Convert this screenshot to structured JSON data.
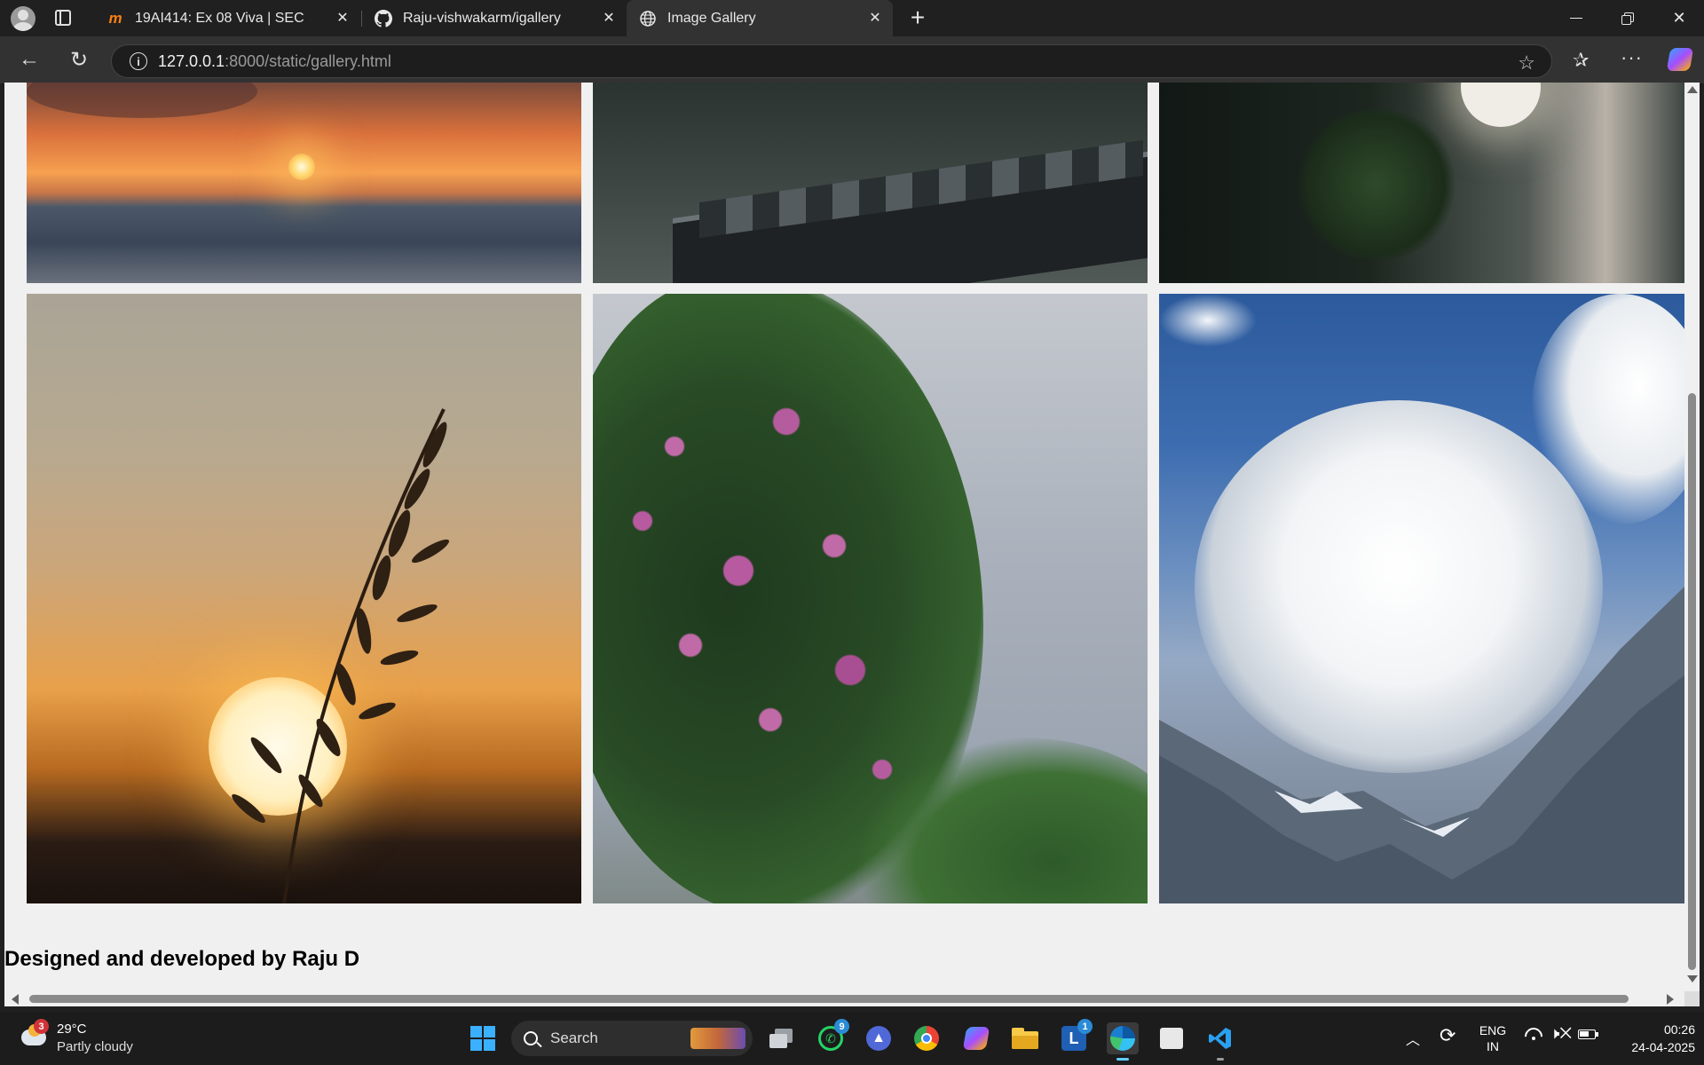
{
  "browser": {
    "tabs": [
      {
        "title": "19AI414: Ex 08 Viva | SEC",
        "icon": "moodle-icon"
      },
      {
        "title": "Raju-vishwakarm/igallery",
        "icon": "github-icon"
      },
      {
        "title": "Image Gallery",
        "icon": "globe-icon",
        "active": true
      }
    ],
    "url_host": "127.0.0.1",
    "url_rest": ":8000/static/gallery.html"
  },
  "page": {
    "photos": [
      {
        "subject": "sunset over sea"
      },
      {
        "subject": "dark rooftop in rain"
      },
      {
        "subject": "moon behind tree"
      },
      {
        "subject": "grass silhouette against sunset"
      },
      {
        "subject": "bougainvillea flowers"
      },
      {
        "subject": "clouds over mountains"
      }
    ],
    "footer": "Designed and developed by Raju D"
  },
  "taskbar": {
    "weather_temp": "29°C",
    "weather_desc": "Partly cloudy",
    "weather_badge": "3",
    "search_label": "Search",
    "whatsapp_badge": "9",
    "l_app_badge": "1",
    "lang_top": "ENG",
    "lang_bottom": "IN",
    "time": "00:26",
    "date": "24-04-2025"
  },
  "colors": {
    "accent": "#0078d4",
    "tab_bar": "#202020",
    "page_bg": "#f0f0f0"
  }
}
